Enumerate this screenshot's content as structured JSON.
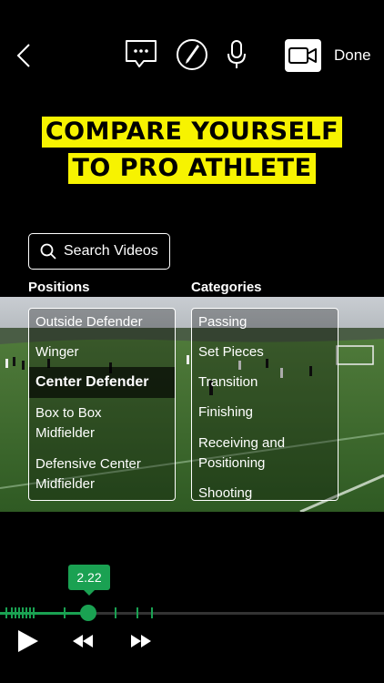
{
  "toolbar": {
    "done_label": "Done",
    "icons": [
      "chevron-left-icon",
      "comment-icon",
      "pen-icon",
      "microphone-icon",
      "video-camera-icon"
    ]
  },
  "headline": {
    "line1": "COMPARE YOURSELF",
    "line2": "TO PRO ATHLETE",
    "highlight_color": "#f7f300"
  },
  "search": {
    "label": "Search Videos"
  },
  "positions": {
    "heading": "Positions",
    "items": [
      {
        "label": "Outside  Defender",
        "selected": false
      },
      {
        "label": "Winger",
        "selected": false
      },
      {
        "label": "Center Defender",
        "selected": true
      },
      {
        "label": "Box to Box\nMidfielder",
        "selected": false
      },
      {
        "label": "Defensive Center\nMidfielder",
        "selected": false
      }
    ]
  },
  "categories": {
    "heading": "Categories",
    "items": [
      {
        "label": "Passing"
      },
      {
        "label": "Set Pieces"
      },
      {
        "label": "Transition"
      },
      {
        "label": "Finishing"
      },
      {
        "label": "Receiving and\nPositioning"
      },
      {
        "label": "Shooting"
      }
    ]
  },
  "playback": {
    "time_label": "2.22",
    "progress_fraction": 0.23,
    "accent_color": "#1aa152",
    "controls": [
      "play-icon",
      "rewind-icon",
      "fast-forward-icon"
    ]
  }
}
